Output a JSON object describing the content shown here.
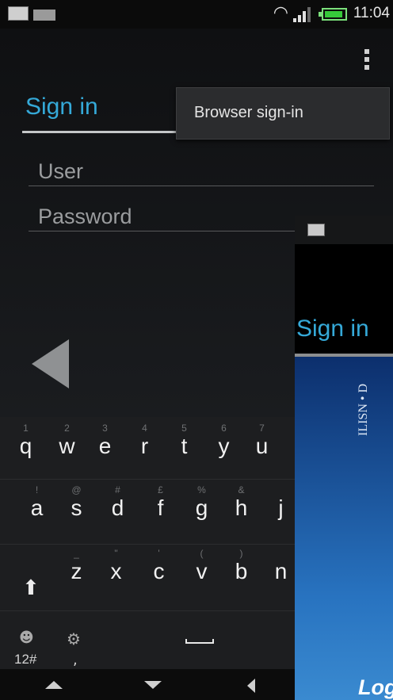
{
  "status_bar": {
    "time": "11:04",
    "icons": [
      "keyboard-notification-icon",
      "email-icon",
      "wifi-icon",
      "signal-icon",
      "battery-icon"
    ]
  },
  "main": {
    "title": "Sign in",
    "user_placeholder": "User",
    "password_placeholder": "Password"
  },
  "menu": {
    "items": [
      {
        "label": "Browser sign-in"
      }
    ]
  },
  "keyboard": {
    "rows": [
      {
        "keys": [
          {
            "hint": "1",
            "label": "q"
          },
          {
            "hint": "2",
            "label": "w"
          },
          {
            "hint": "3",
            "label": "e"
          },
          {
            "hint": "4",
            "label": "r"
          },
          {
            "hint": "5",
            "label": "t"
          },
          {
            "hint": "6",
            "label": "y"
          },
          {
            "hint": "7",
            "label": "u"
          }
        ]
      },
      {
        "keys": [
          {
            "hint": "!",
            "label": "a"
          },
          {
            "hint": "@",
            "label": "s"
          },
          {
            "hint": "#",
            "label": "d"
          },
          {
            "hint": "£",
            "label": "f"
          },
          {
            "hint": "%",
            "label": "g"
          },
          {
            "hint": "&",
            "label": "h"
          },
          {
            "hint": "",
            "label": "j"
          }
        ]
      },
      {
        "keys": [
          {
            "hint": "_",
            "label": "z"
          },
          {
            "hint": "\"",
            "label": "x"
          },
          {
            "hint": "'",
            "label": "c"
          },
          {
            "hint": "(",
            "label": "v"
          },
          {
            "hint": ")",
            "label": "b"
          },
          {
            "hint": "",
            "label": "n"
          }
        ]
      }
    ],
    "symbols_label": "12#",
    "comma_label": ","
  },
  "second_window": {
    "title": "Sign in",
    "vertical_text": "ILISN • D",
    "logo_text": "Log"
  },
  "colors": {
    "accent": "#35a9d8",
    "keyboard_bg": "#1d1e20",
    "panel_blue": "#1d5aa5"
  }
}
